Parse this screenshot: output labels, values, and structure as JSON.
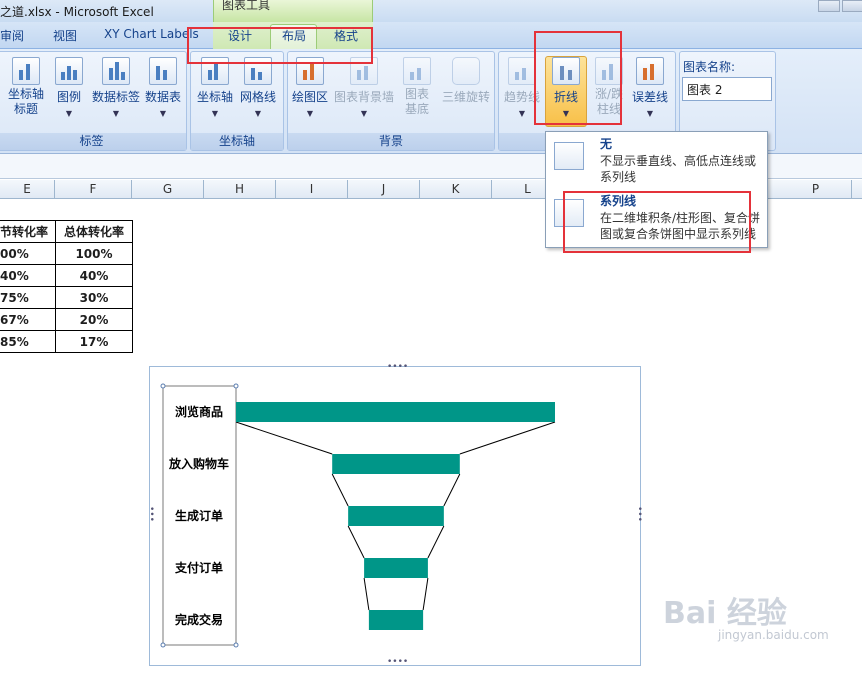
{
  "window": {
    "title": "之道.xlsx - Microsoft Excel",
    "context_group": "图表工具"
  },
  "tabs": [
    "审阅",
    "视图",
    "XY Chart Labels",
    "设计",
    "布局",
    "格式"
  ],
  "active_tab": "布局",
  "ribbon": {
    "groups": [
      {
        "label": "标签",
        "buttons": [
          "坐标轴标题",
          "图例",
          "数据标签",
          "数据表"
        ]
      },
      {
        "label": "坐标轴",
        "buttons": [
          "坐标轴",
          "网格线"
        ]
      },
      {
        "label": "背景",
        "buttons": [
          "绘图区",
          "图表背景墙",
          "图表基底",
          "三维旋转"
        ]
      },
      {
        "label": "",
        "buttons": [
          "趋势线",
          "折线",
          "涨/跌柱线",
          "误差线"
        ]
      }
    ],
    "chart_name_label": "图表名称:",
    "chart_name_value": "图表 2"
  },
  "line_dropdown": {
    "items": [
      {
        "title": "无",
        "description": "不显示垂直线、高低点连线或系列线"
      },
      {
        "title": "系列线",
        "description": "在二维堆积条/柱形图、复合饼图或复合条饼图中显示系列线"
      }
    ]
  },
  "columns": [
    "E",
    "F",
    "G",
    "H",
    "I",
    "J",
    "K",
    "L",
    "P"
  ],
  "table": {
    "headers": [
      "节转化率",
      "总体转化率"
    ],
    "rows": [
      [
        "00%",
        "100%"
      ],
      [
        "40%",
        "40%"
      ],
      [
        "75%",
        "30%"
      ],
      [
        "67%",
        "20%"
      ],
      [
        "85%",
        "17%"
      ]
    ]
  },
  "chart_data": {
    "type": "bar",
    "categories": [
      "浏览商品",
      "放入购物车",
      "生成订单",
      "支付订单",
      "完成交易"
    ],
    "values": [
      100,
      40,
      30,
      20,
      17
    ],
    "bar_color": "#009688",
    "series_lines": true,
    "title": "",
    "xlabel": "",
    "ylabel": ""
  },
  "watermark": {
    "main": "Bai 经验",
    "sub": "jingyan.baidu.com"
  }
}
